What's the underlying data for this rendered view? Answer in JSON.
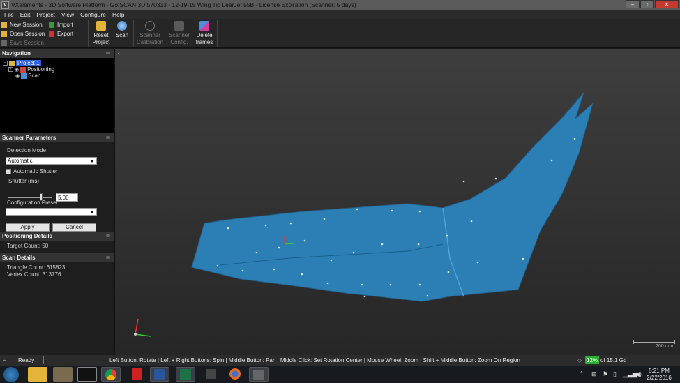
{
  "window": {
    "title": "VXelements - 3D Software Platform - Go!SCAN 3D 570313 - 12-19-15 Wing Tip LearJet 55B - License Expiration (Scanner: 5 days)"
  },
  "menu": [
    "File",
    "Edit",
    "Project",
    "View",
    "Configure",
    "Help"
  ],
  "toolbar": {
    "new_session": "New Session",
    "open_session": "Open Session",
    "save_session": "Save Session",
    "import": "Import",
    "export": "Export",
    "reset_project": [
      "Reset",
      "Project"
    ],
    "scan": "Scan",
    "scanner_calibration": [
      "Scanner",
      "Calibration"
    ],
    "scanner_config": [
      "Scanner",
      "Config."
    ],
    "delete_frames": [
      "Delete",
      "frames"
    ]
  },
  "navigation": {
    "header": "Navigation",
    "tree": [
      "Project 1",
      "Positioning",
      "Scan"
    ]
  },
  "scanner_parameters": {
    "header": "Scanner Parameters",
    "detection_mode_label": "Detection Mode",
    "detection_mode_value": "Automatic",
    "automatic_shutter_label": "Automatic Shutter",
    "shutter_label": "Shutter (ms)",
    "shutter_value": "5.00",
    "shutter_slider_fraction": 0.75,
    "config_preset_label": "Configuration Preset",
    "config_preset_value": "",
    "apply_label": "Apply",
    "cancel_label": "Cancel"
  },
  "positioning_details": {
    "header": "Positioning Details",
    "target_count": "Target Count: 50"
  },
  "scan_details": {
    "header": "Scan Details",
    "triangle_count": "Triangle Count: 615823",
    "vertex_count": "Vertex Count: 313776"
  },
  "viewport": {
    "scale_label": "200 mm",
    "model_color": "#2b7fb5"
  },
  "status": {
    "ready": "Ready",
    "help": "Left Button: Rotate  |  Left + Right Buttons: Spin  |  Middle Button: Pan  |  Middle Click: Set Rotation Center  |  Mouse Wheel: Zoom  |  Shift + Middle Button: Zoom On Region",
    "memory_percent": "12%",
    "memory_total": "of 15.1 Gb"
  },
  "clock": {
    "time": "5:21 PM",
    "date": "2/22/2016"
  }
}
